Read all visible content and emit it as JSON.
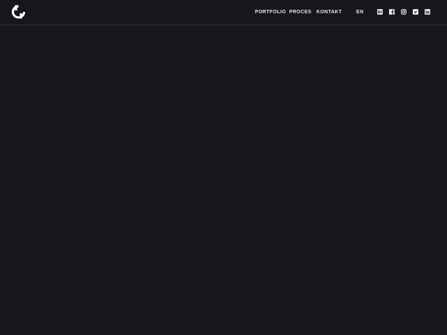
{
  "header": {
    "logo_icon": "brand-logo-icon",
    "nav": [
      {
        "label": "PORTFOLIO"
      },
      {
        "label": "PROCES"
      },
      {
        "label": "KONTAKT"
      }
    ],
    "language": "EN",
    "social_icons": [
      "behance-icon",
      "facebook-icon",
      "instagram-icon",
      "vimeo-icon",
      "linkedin-icon"
    ]
  },
  "colors": {
    "background": "#16171a",
    "text": "#e8e8ea",
    "divider": "#2a2b2f"
  }
}
